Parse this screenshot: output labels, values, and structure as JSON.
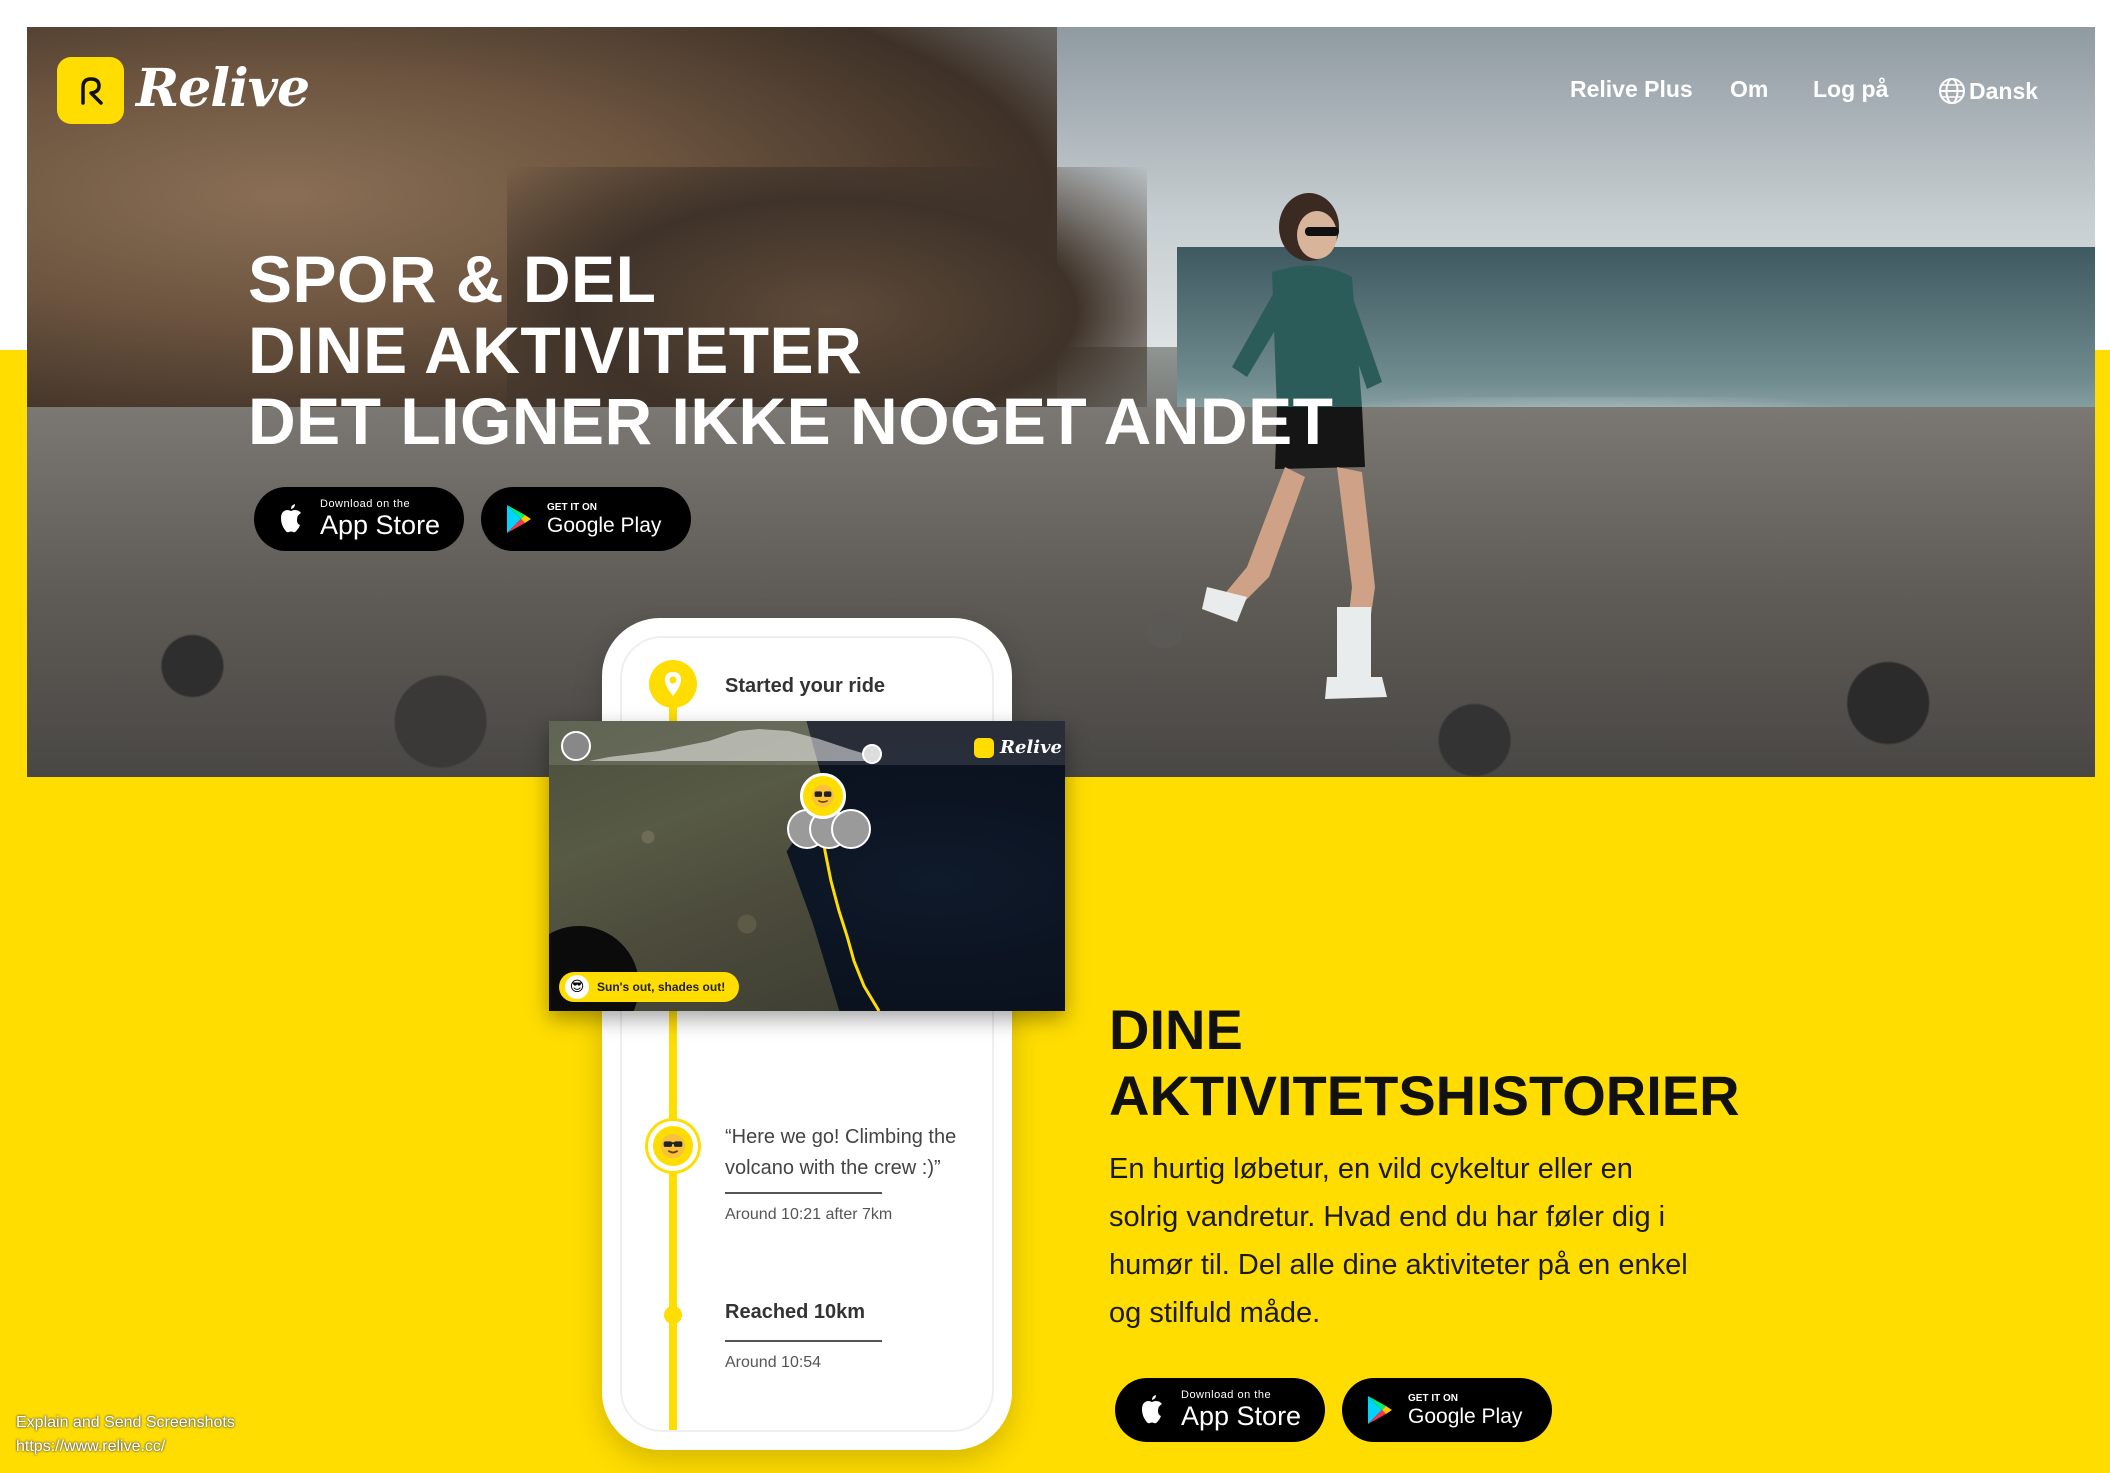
{
  "brand": {
    "name": "Relive"
  },
  "nav": {
    "links": [
      "Relive Plus",
      "Om",
      "Log på"
    ],
    "language": "Dansk"
  },
  "hero": {
    "headline": [
      "SPOR & DEL",
      "DINE AKTIVITETER",
      "DET LIGNER IKKE NOGET ANDET"
    ]
  },
  "stores": {
    "apple_small": "Download on the",
    "apple_big": "App Store",
    "google_small": "GET IT ON",
    "google_big": "Google Play"
  },
  "phone": {
    "started": "Started your ride",
    "quote": "“Here we go! Climbing the volcano with the crew :)”",
    "quote_time": "Around 10:21 after 7km",
    "reached": "Reached 10km",
    "reached_time": "Around 10:54",
    "map_brand": "Relive",
    "map_tag": "Sun's out, shades out!"
  },
  "section": {
    "title": [
      "DINE",
      "AKTIVITETSHISTORIER"
    ],
    "body": "En hurtig løbetur, en vild cykeltur eller en solrig vandretur. Hvad end du har føler dig i humør til. Del alle dine aktiviteter på en enkel og stilfuld måde."
  },
  "extension_overlay": {
    "title": "Explain and Send Screenshots",
    "url": "https://www.relive.cc/"
  },
  "colors": {
    "accent": "#FFDD00",
    "dark": "#000000",
    "text": "#111111"
  }
}
